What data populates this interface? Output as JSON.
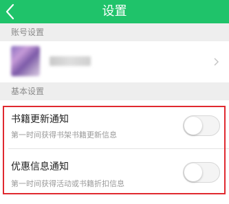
{
  "header": {
    "title": "设置",
    "background_color": "#1fc36a",
    "back_icon": "chevron-left-icon"
  },
  "sections": {
    "account": {
      "label": "账号设置"
    },
    "basic": {
      "label": "基本设置"
    }
  },
  "settings": [
    {
      "title": "书籍更新通知",
      "description": "第一时间获得书架书籍更新信息",
      "enabled": false
    },
    {
      "title": "优惠信息通知",
      "description": "第一时间获得活动或书籍折扣信息",
      "enabled": false
    }
  ],
  "highlight_color": "#e0282e"
}
